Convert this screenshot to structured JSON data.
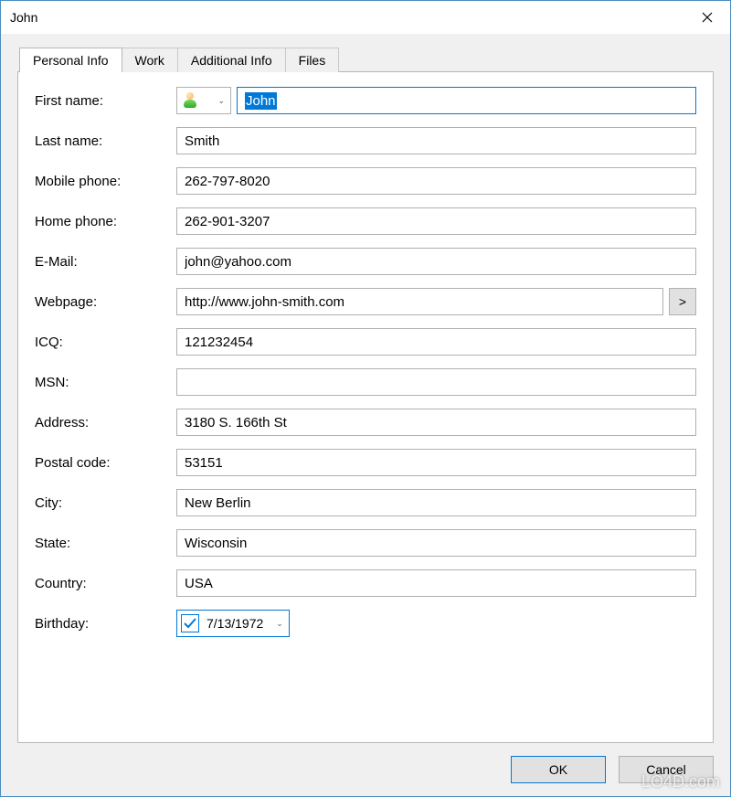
{
  "window": {
    "title": "John"
  },
  "tabs": [
    {
      "label": "Personal Info",
      "active": true
    },
    {
      "label": "Work",
      "active": false
    },
    {
      "label": "Additional Info",
      "active": false
    },
    {
      "label": "Files",
      "active": false
    }
  ],
  "labels": {
    "first_name": "First name:",
    "last_name": "Last name:",
    "mobile": "Mobile phone:",
    "home": "Home phone:",
    "email": "E-Mail:",
    "webpage": "Webpage:",
    "icq": "ICQ:",
    "msn": "MSN:",
    "address": "Address:",
    "postal": "Postal code:",
    "city": "City:",
    "state": "State:",
    "country": "Country:",
    "birthday": "Birthday:"
  },
  "values": {
    "first_name": "John",
    "last_name": "Smith",
    "mobile": "262-797-8020",
    "home": "262-901-3207",
    "email": "john@yahoo.com",
    "webpage": "http://www.john-smith.com",
    "icq": "121232454",
    "msn": "",
    "address": "3180 S. 166th St",
    "postal": "53151",
    "city": "New Berlin",
    "state": "Wisconsin",
    "country": "USA",
    "birthday": "7/13/1972"
  },
  "buttons": {
    "webpage_go": ">",
    "ok": "OK",
    "cancel": "Cancel"
  },
  "watermark": "LO4D.com"
}
